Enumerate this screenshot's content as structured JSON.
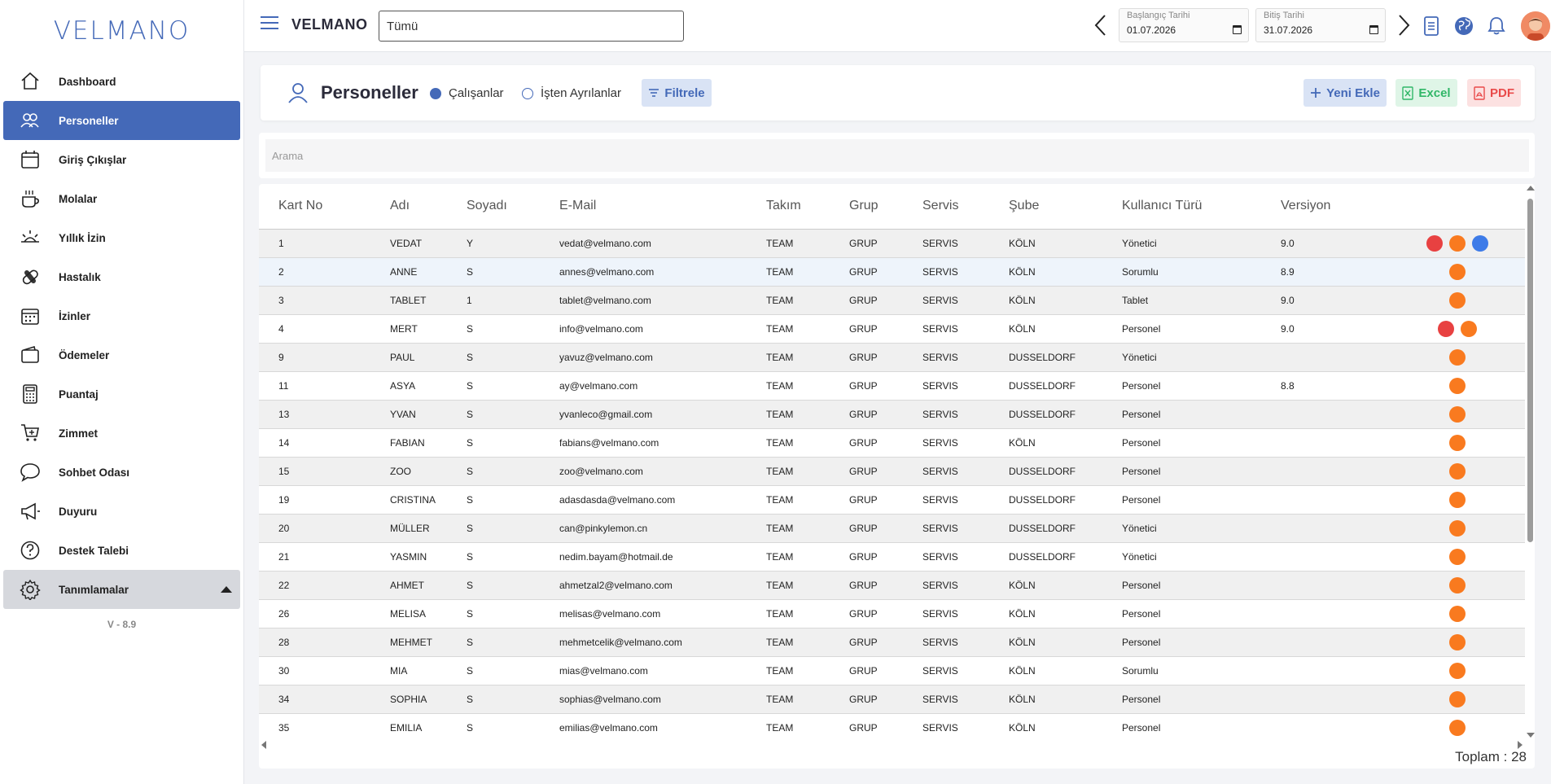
{
  "app": {
    "logo": "VELMANO",
    "brand": "VELMANO",
    "version": "V - 8.9"
  },
  "sidebar": {
    "items": [
      {
        "label": "Dashboard",
        "icon": "home-icon"
      },
      {
        "label": "Personeller",
        "icon": "users-icon",
        "active": true
      },
      {
        "label": "Giriş Çıkışlar",
        "icon": "calendar-icon"
      },
      {
        "label": "Molalar",
        "icon": "coffee-icon"
      },
      {
        "label": "Yıllık İzin",
        "icon": "sunset-icon"
      },
      {
        "label": "Hastalık",
        "icon": "pill-icon"
      },
      {
        "label": "İzinler",
        "icon": "calendar-days-icon"
      },
      {
        "label": "Ödemeler",
        "icon": "wallet-icon"
      },
      {
        "label": "Puantaj",
        "icon": "calculator-icon"
      },
      {
        "label": "Zimmet",
        "icon": "cart-icon"
      },
      {
        "label": "Sohbet Odası",
        "icon": "chat-icon"
      },
      {
        "label": "Duyuru",
        "icon": "megaphone-icon"
      },
      {
        "label": "Destek Talebi",
        "icon": "help-circle-icon"
      },
      {
        "label": "Tanımlamalar",
        "icon": "gear-icon",
        "expandable": true
      }
    ]
  },
  "topbar": {
    "scope_value": "Tümü",
    "start_date_label": "Başlangıç Tarihi",
    "start_date": "01.07.2026",
    "end_date_label": "Bitiş Tarihi",
    "end_date": "31.07.2026"
  },
  "header": {
    "title": "Personeller",
    "radio_active": "Çalışanlar",
    "radio_left": "İşten Ayrılanlar",
    "filter_label": "Filtrele",
    "add_label": "Yeni Ekle",
    "excel_label": "Excel",
    "pdf_label": "PDF"
  },
  "search": {
    "placeholder": "Arama"
  },
  "colors": {
    "primary": "#4469b8",
    "red": "#e84141",
    "orange": "#f97a1f",
    "blue": "#3d7be8"
  },
  "table": {
    "columns": [
      "Kart No",
      "Adı",
      "Soyadı",
      "E-Mail",
      "Takım",
      "Grup",
      "Servis",
      "Şube",
      "Kullanıcı Türü",
      "Versiyon",
      ""
    ],
    "rows": [
      {
        "kart": "1",
        "ad": "VEDAT",
        "soyad": "Y",
        "email": "vedat@velmano.com",
        "takim": "TEAM",
        "grup": "GRUP",
        "servis": "SERVIS",
        "sube": "KÖLN",
        "tur": "Yönetici",
        "versiyon": "9.0",
        "status": [
          "red",
          "orange",
          "blue"
        ]
      },
      {
        "kart": "2",
        "ad": "ANNE",
        "soyad": "S",
        "email": "annes@velmano.com",
        "takim": "TEAM",
        "grup": "GRUP",
        "servis": "SERVIS",
        "sube": "KÖLN",
        "tur": "Sorumlu",
        "versiyon": "8.9",
        "status": [
          "orange"
        ]
      },
      {
        "kart": "3",
        "ad": "TABLET",
        "soyad": "1",
        "email": "tablet@velmano.com",
        "takim": "TEAM",
        "grup": "GRUP",
        "servis": "SERVIS",
        "sube": "KÖLN",
        "tur": "Tablet",
        "versiyon": "9.0",
        "status": [
          "orange"
        ]
      },
      {
        "kart": "4",
        "ad": "MERT",
        "soyad": "S",
        "email": "info@velmano.com",
        "takim": "TEAM",
        "grup": "GRUP",
        "servis": "SERVIS",
        "sube": "KÖLN",
        "tur": "Personel",
        "versiyon": "9.0",
        "status": [
          "red",
          "orange"
        ]
      },
      {
        "kart": "9",
        "ad": "PAUL",
        "soyad": "S",
        "email": "yavuz@velmano.com",
        "takim": "TEAM",
        "grup": "GRUP",
        "servis": "SERVIS",
        "sube": "DUSSELDORF",
        "tur": "Yönetici",
        "versiyon": "",
        "status": [
          "orange"
        ]
      },
      {
        "kart": "11",
        "ad": "ASYA",
        "soyad": "S",
        "email": "ay@velmano.com",
        "takim": "TEAM",
        "grup": "GRUP",
        "servis": "SERVIS",
        "sube": "DUSSELDORF",
        "tur": "Personel",
        "versiyon": "8.8",
        "status": [
          "orange"
        ]
      },
      {
        "kart": "13",
        "ad": "YVAN",
        "soyad": "S",
        "email": "yvanleco@gmail.com",
        "takim": "TEAM",
        "grup": "GRUP",
        "servis": "SERVIS",
        "sube": "DUSSELDORF",
        "tur": "Personel",
        "versiyon": "",
        "status": [
          "orange"
        ]
      },
      {
        "kart": "14",
        "ad": "FABIAN",
        "soyad": "S",
        "email": "fabians@velmano.com",
        "takim": "TEAM",
        "grup": "GRUP",
        "servis": "SERVIS",
        "sube": "KÖLN",
        "tur": "Personel",
        "versiyon": "",
        "status": [
          "orange"
        ]
      },
      {
        "kart": "15",
        "ad": "ZOO",
        "soyad": "S",
        "email": "zoo@velmano.com",
        "takim": "TEAM",
        "grup": "GRUP",
        "servis": "SERVIS",
        "sube": "DUSSELDORF",
        "tur": "Personel",
        "versiyon": "",
        "status": [
          "orange"
        ]
      },
      {
        "kart": "19",
        "ad": "CRISTINA",
        "soyad": "S",
        "email": "adasdasda@velmano.com",
        "takim": "TEAM",
        "grup": "GRUP",
        "servis": "SERVIS",
        "sube": "DUSSELDORF",
        "tur": "Personel",
        "versiyon": "",
        "status": [
          "orange"
        ]
      },
      {
        "kart": "20",
        "ad": "MÜLLER",
        "soyad": "S",
        "email": "can@pinkylemon.cn",
        "takim": "TEAM",
        "grup": "GRUP",
        "servis": "SERVIS",
        "sube": "DUSSELDORF",
        "tur": "Yönetici",
        "versiyon": "",
        "status": [
          "orange"
        ]
      },
      {
        "kart": "21",
        "ad": "YASMIN",
        "soyad": "S",
        "email": "nedim.bayam@hotmail.de",
        "takim": "TEAM",
        "grup": "GRUP",
        "servis": "SERVIS",
        "sube": "DUSSELDORF",
        "tur": "Yönetici",
        "versiyon": "",
        "status": [
          "orange"
        ]
      },
      {
        "kart": "22",
        "ad": "AHMET",
        "soyad": "S",
        "email": "ahmetzal2@velmano.com",
        "takim": "TEAM",
        "grup": "GRUP",
        "servis": "SERVIS",
        "sube": "KÖLN",
        "tur": "Personel",
        "versiyon": "",
        "status": [
          "orange"
        ]
      },
      {
        "kart": "26",
        "ad": "MELISA",
        "soyad": "S",
        "email": "melisas@velmano.com",
        "takim": "TEAM",
        "grup": "GRUP",
        "servis": "SERVIS",
        "sube": "KÖLN",
        "tur": "Personel",
        "versiyon": "",
        "status": [
          "orange"
        ]
      },
      {
        "kart": "28",
        "ad": "MEHMET",
        "soyad": "S",
        "email": "mehmetcelik@velmano.com",
        "takim": "TEAM",
        "grup": "GRUP",
        "servis": "SERVIS",
        "sube": "KÖLN",
        "tur": "Personel",
        "versiyon": "",
        "status": [
          "orange"
        ]
      },
      {
        "kart": "30",
        "ad": "MIA",
        "soyad": "S",
        "email": "mias@velmano.com",
        "takim": "TEAM",
        "grup": "GRUP",
        "servis": "SERVIS",
        "sube": "KÖLN",
        "tur": "Sorumlu",
        "versiyon": "",
        "status": [
          "orange"
        ]
      },
      {
        "kart": "34",
        "ad": "SOPHIA",
        "soyad": "S",
        "email": "sophias@velmano.com",
        "takim": "TEAM",
        "grup": "GRUP",
        "servis": "SERVIS",
        "sube": "KÖLN",
        "tur": "Personel",
        "versiyon": "",
        "status": [
          "orange"
        ]
      },
      {
        "kart": "35",
        "ad": "EMILIA",
        "soyad": "S",
        "email": "emilias@velmano.com",
        "takim": "TEAM",
        "grup": "GRUP",
        "servis": "SERVIS",
        "sube": "KÖLN",
        "tur": "Personel",
        "versiyon": "",
        "status": [
          "orange"
        ]
      }
    ],
    "total_text": "Toplam : 28"
  }
}
